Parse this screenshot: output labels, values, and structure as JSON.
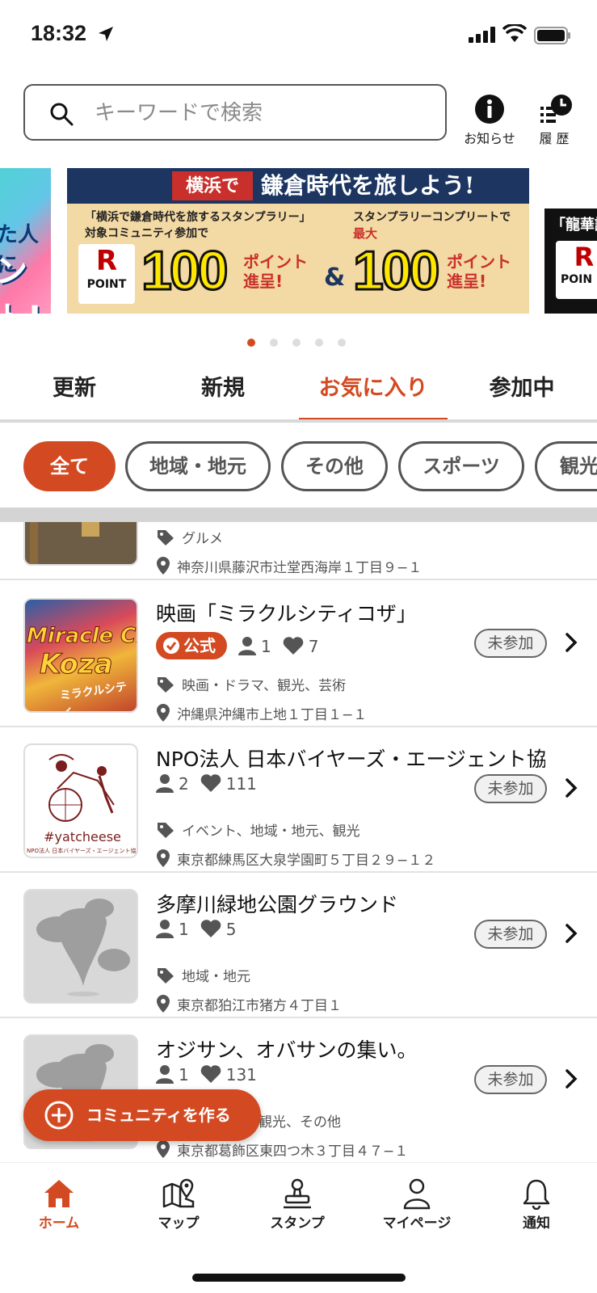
{
  "status_bar": {
    "time": "18:32"
  },
  "search": {
    "placeholder": "キーワードで検索"
  },
  "header": {
    "news_label": "お知らせ",
    "history_label": "履 歴"
  },
  "carousel": {
    "left_banner": {
      "line1": "た人に",
      "line2": "ント!"
    },
    "main_banner": {
      "prefix": "横浜で",
      "title": "鎌倉時代を旅しよう!",
      "left_note_line1": "「横浜で鎌倉時代を旅するスタンプラリー」",
      "left_note_line2": "対象コミュニティ参加で",
      "right_note_line1": "スタンプラリーコンプリートで",
      "right_note_line2": "最大",
      "r_logo": "R",
      "point_word": "POINT",
      "amount_left": "100",
      "amount_right": "100",
      "points_gift_line1": "ポイント",
      "points_gift_line2": "進呈!",
      "amp": "&"
    },
    "right_banner": {
      "title": "「龍華議",
      "r_logo": "R",
      "point_word": "POIN"
    },
    "dots": 5,
    "active_dot": 0
  },
  "tabs": [
    {
      "label": "更新"
    },
    {
      "label": "新規"
    },
    {
      "label": "お気に入り",
      "active": true
    },
    {
      "label": "参加中"
    }
  ],
  "chips": [
    {
      "label": "全て",
      "active": true
    },
    {
      "label": "地域・地元"
    },
    {
      "label": "その他"
    },
    {
      "label": "スポーツ"
    },
    {
      "label": "観光"
    }
  ],
  "communities": [
    {
      "name": "",
      "tags": "グルメ",
      "address": "神奈川県藤沢市辻堂西海岸１丁目９−１"
    },
    {
      "name": "映画「ミラクルシティコザ」",
      "official": "公式",
      "members": "1",
      "likes": "7",
      "status": "未参加",
      "tags": "映画・ドラマ、観光、芸術",
      "address": "沖縄県沖縄市上地１丁目１−１",
      "thumb_text1": "Miracle City",
      "thumb_text2": "Koza",
      "thumb_text3": "ミラクルシティ"
    },
    {
      "name": "NPO法人 日本バイヤーズ・エージェント協",
      "members": "2",
      "likes": "111",
      "status": "未参加",
      "tags": "イベント、地域・地元、観光",
      "address": "東京都練馬区大泉学園町５丁目２９−１２",
      "thumb_text1": "#yatcheese",
      "thumb_text2": "NPO法人 日本バイヤーズ・エージェント協会"
    },
    {
      "name": "多摩川緑地公園グラウンド",
      "members": "1",
      "likes": "5",
      "status": "未参加",
      "tags": "地域・地元",
      "address": "東京都狛江市猪方４丁目１"
    },
    {
      "name": "オジサン、オバサンの集い。",
      "members": "1",
      "likes": "131",
      "status": "未参加",
      "tags": "観光、その他",
      "address": "東京都葛飾区東四つ木３丁目４７−１"
    }
  ],
  "fab": {
    "label": "コミュニティを作る"
  },
  "bottom_nav": [
    {
      "label": "ホーム",
      "active": true
    },
    {
      "label": "マップ"
    },
    {
      "label": "スタンプ"
    },
    {
      "label": "マイページ"
    },
    {
      "label": "通知"
    }
  ],
  "colors": {
    "accent": "#d34a22",
    "navy": "#1c3561"
  }
}
